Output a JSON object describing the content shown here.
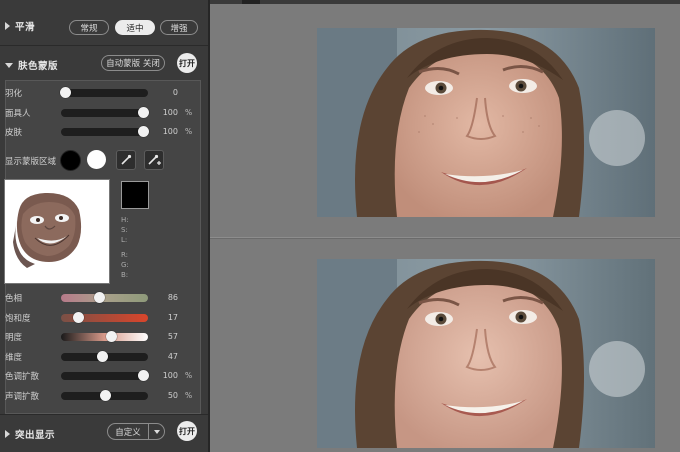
{
  "smooth": {
    "title": "平滑",
    "modes": [
      "常规",
      "适中",
      "增强"
    ],
    "active_mode": "适中"
  },
  "skin_mask": {
    "title": "肤色蒙版",
    "auto_mask_label": "自动蒙版 关闭",
    "toggle_label": "打开",
    "sliders_top": [
      {
        "label": "羽化",
        "value": "0",
        "unit": "",
        "pos": 0.05
      },
      {
        "label": "面具人",
        "value": "100",
        "unit": "%",
        "pos": 0.94
      },
      {
        "label": "皮肤",
        "value": "100",
        "unit": "%",
        "pos": 0.94
      }
    ],
    "show_area_label": "显示蒙版区域",
    "info": {
      "hsl": [
        "H:",
        "S:",
        "L:"
      ],
      "rgb": [
        "R:",
        "G:",
        "B:"
      ]
    },
    "sliders_bottom": [
      {
        "label": "色相",
        "value": "86",
        "unit": "",
        "pos": 0.44
      },
      {
        "label": "饱和度",
        "value": "17",
        "unit": "",
        "pos": 0.2
      },
      {
        "label": "明度",
        "value": "57",
        "unit": "",
        "pos": 0.57
      },
      {
        "label": "维度",
        "value": "47",
        "unit": "",
        "pos": 0.47
      },
      {
        "label": "色调扩散",
        "value": "100",
        "unit": "%",
        "pos": 0.94
      },
      {
        "label": "声调扩散",
        "value": "50",
        "unit": "%",
        "pos": 0.5
      }
    ]
  },
  "highlight": {
    "title": "突出显示",
    "dropdown_value": "自定义",
    "toggle_label": "打开"
  },
  "icons": {
    "eyedropper": "eyedropper-icon",
    "eyedropper_plus": "eyedropper-plus-icon"
  }
}
